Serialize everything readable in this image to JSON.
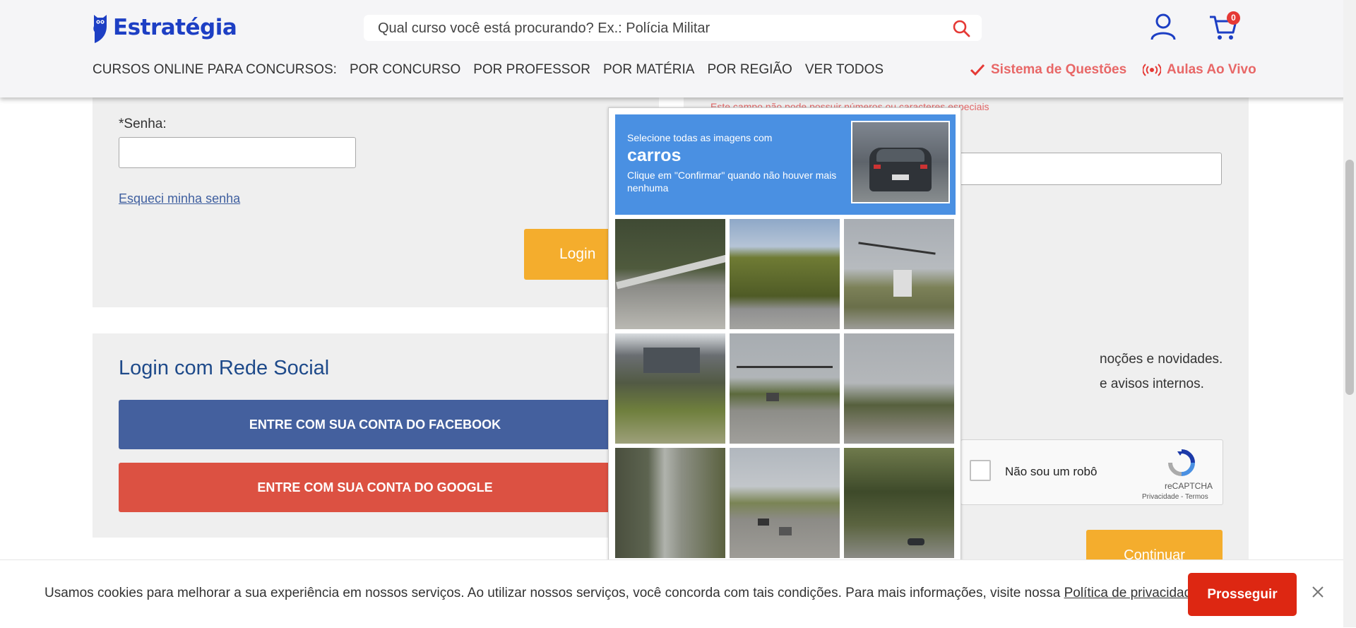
{
  "header": {
    "logo_text": "Estratégia",
    "search": {
      "placeholder": "Qual curso você está procurando? Ex.: Polícia Militar"
    },
    "cart_count": "0",
    "nav": {
      "lead": "CURSOS ONLINE PARA CONCURSOS:",
      "items": [
        "POR CONCURSO",
        "POR PROFESSOR",
        "POR MATÉRIA",
        "POR REGIÃO",
        "VER TODOS"
      ]
    },
    "sistema_questoes": "Sistema de Questões",
    "aulas_ao_vivo": "Aulas Ao Vivo"
  },
  "login": {
    "senha_label": "*Senha:",
    "forgot_link": "Esqueci minha senha",
    "login_button": "Login"
  },
  "social": {
    "title": "Login com Rede Social",
    "facebook_button": "ENTRE COM SUA CONTA DO FACEBOOK",
    "google_button": "ENTRE COM SUA CONTA DO GOOGLE"
  },
  "register": {
    "error_text": "Este campo não pode possuir números ou caracteres especiais",
    "promo_visible": "noções e novidades.",
    "aviso_visible": "e avisos internos.",
    "continue_button": "Continuar"
  },
  "recaptcha": {
    "label": "Não sou um robô",
    "brand": "reCAPTCHA",
    "links": "Privacidade - Termos"
  },
  "captcha": {
    "instruction": "Selecione todas as imagens com",
    "target": "carros",
    "hint": "Clique em \"Confirmar\" quando não houver mais nenhuma",
    "tiles": [
      "tile-1",
      "tile-2",
      "tile-3",
      "tile-4",
      "tile-5",
      "tile-6",
      "tile-7",
      "tile-8",
      "tile-9"
    ]
  },
  "cookie": {
    "text": "Usamos cookies para melhorar a sua experiência em nossos serviços. Ao utilizar nossos serviços, você concorda com tais condições. Para mais informações, visite nossa ",
    "link": "Política de privacidade",
    "end": ".",
    "button": "Prosseguir"
  },
  "colors": {
    "brand_blue": "#1d3fc4",
    "accent_orange": "#f4ad2d",
    "facebook": "#44609e",
    "google": "#dc5142",
    "captcha_blue": "#4a90e2",
    "cookie_button": "#dd2712",
    "link_red": "#e86767"
  }
}
